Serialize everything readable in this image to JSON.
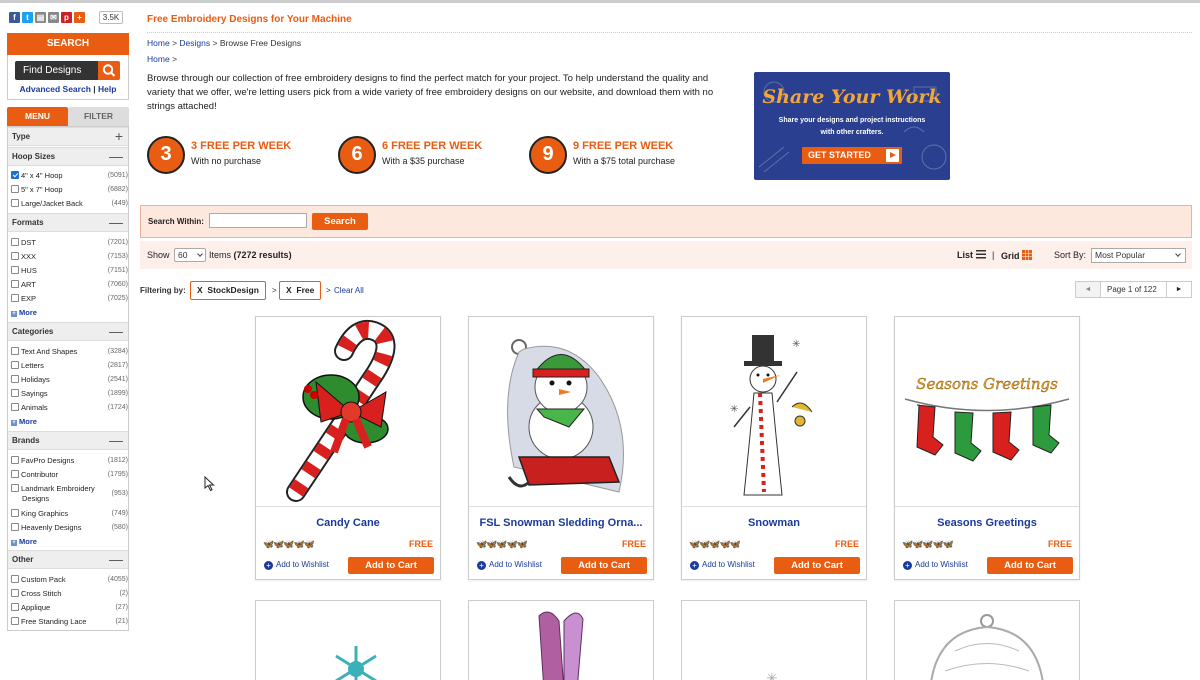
{
  "social": {
    "share_count": "3.5K"
  },
  "colors": {
    "brand": "#e85d12",
    "link": "#1a3a9c",
    "facebook": "#3b5998",
    "twitter": "#1da1f2",
    "pinterest": "#cb2027",
    "email": "#888888"
  },
  "page": {
    "title": "Free Embroidery Designs for Your Machine"
  },
  "breadcrumb": {
    "home": "Home",
    "sep1": ">",
    "designs": "Designs",
    "sep2": ">",
    "current": "Browse Free Designs"
  },
  "breadcrumb2": {
    "home": "Home",
    "sep": ">"
  },
  "intro": "Browse through our collection of free embroidery designs to find the perfect match for your project. To help understand the quality and variety that we offer, we're letting users pick from a wide variety of free embroidery designs on our website, and download them with no strings attached!",
  "offers": [
    {
      "num": "3",
      "heading": "3 FREE PER WEEK",
      "sub": "With no purchase"
    },
    {
      "num": "6",
      "heading": "6 FREE PER WEEK",
      "sub": "With a $35 purchase"
    },
    {
      "num": "9",
      "heading": "9 FREE PER WEEK",
      "sub": "With a $75 total purchase"
    }
  ],
  "promo": {
    "title": "Share Your Work",
    "sub": "Share your designs and project instructions with other crafters.",
    "button": "GET STARTED"
  },
  "sidebar": {
    "search_head": "SEARCH",
    "find_placeholder": "Find Designs",
    "advanced": "Advanced Search",
    "sep": "|",
    "help": "Help",
    "tab_menu": "MENU",
    "tab_filter": "FILTER",
    "more": "More",
    "sections": {
      "type": {
        "label": "Type",
        "sym": "+"
      },
      "hoop": {
        "label": "Hoop Sizes",
        "sym": "—",
        "items": [
          {
            "label": "4\" x 4\" Hoop",
            "count": "(5091)",
            "checked": true
          },
          {
            "label": "5\" x 7\" Hoop",
            "count": "(6882)"
          },
          {
            "label": "Large/Jacket Back",
            "count": "(449)"
          }
        ]
      },
      "formats": {
        "label": "Formats",
        "sym": "—",
        "items": [
          {
            "label": "DST",
            "count": "(7201)"
          },
          {
            "label": "XXX",
            "count": "(7153)"
          },
          {
            "label": "HUS",
            "count": "(7151)"
          },
          {
            "label": "ART",
            "count": "(7060)"
          },
          {
            "label": "EXP",
            "count": "(7025)"
          }
        ]
      },
      "categories": {
        "label": "Categories",
        "sym": "—",
        "items": [
          {
            "label": "Text And Shapes",
            "count": "(3284)"
          },
          {
            "label": "Letters",
            "count": "(2817)"
          },
          {
            "label": "Holidays",
            "count": "(2541)"
          },
          {
            "label": "Sayings",
            "count": "(1899)"
          },
          {
            "label": "Animals",
            "count": "(1724)"
          }
        ]
      },
      "brands": {
        "label": "Brands",
        "sym": "—",
        "items": [
          {
            "label": "FavPro Designs",
            "count": "(1812)"
          },
          {
            "label": "Contributor",
            "count": "(1795)"
          },
          {
            "label": "Landmark Embroidery Designs",
            "count": "(953)"
          },
          {
            "label": "King Graphics",
            "count": "(749)"
          },
          {
            "label": "Heavenly Designs",
            "count": "(580)"
          }
        ]
      },
      "other": {
        "label": "Other",
        "sym": "—",
        "items": [
          {
            "label": "Custom Pack",
            "count": "(4055)"
          },
          {
            "label": "Cross Stitch",
            "count": "(2)"
          },
          {
            "label": "Applique",
            "count": "(27)"
          },
          {
            "label": "Free Standing Lace",
            "count": "(21)"
          }
        ]
      }
    }
  },
  "within": {
    "label": "Search Within:",
    "button": "Search"
  },
  "showbar": {
    "show": "Show",
    "per_page": "60",
    "items_prefix": "Items",
    "results": "(7272 results)",
    "list": "List",
    "divider": "|",
    "grid": "Grid",
    "sort_label": "Sort By:",
    "sort_value": "Most Popular"
  },
  "filtering": {
    "label": "Filtering by:",
    "chip1": "StockDesign",
    "chip2": "Free",
    "x": "X",
    "sep": ">",
    "clear": "Clear All"
  },
  "pager": {
    "prev": "◄",
    "info": "Page 1 of 122",
    "next": "►"
  },
  "products": [
    {
      "name": "Candy Cane",
      "price": "FREE",
      "wishlist": "Add to Wishlist",
      "cart": "Add to Cart",
      "rating": 4.5
    },
    {
      "name": "FSL Snowman Sledding Orna...",
      "price": "FREE",
      "wishlist": "Add to Wishlist",
      "cart": "Add to Cart",
      "rating": 4.5
    },
    {
      "name": "Snowman",
      "price": "FREE",
      "wishlist": "Add to Wishlist",
      "cart": "Add to Cart",
      "rating": 4.5
    },
    {
      "name": "Seasons Greetings",
      "price": "FREE",
      "wishlist": "Add to Wishlist",
      "cart": "Add to Cart",
      "rating": 4.5,
      "image_text": "Seasons Greetings"
    }
  ]
}
